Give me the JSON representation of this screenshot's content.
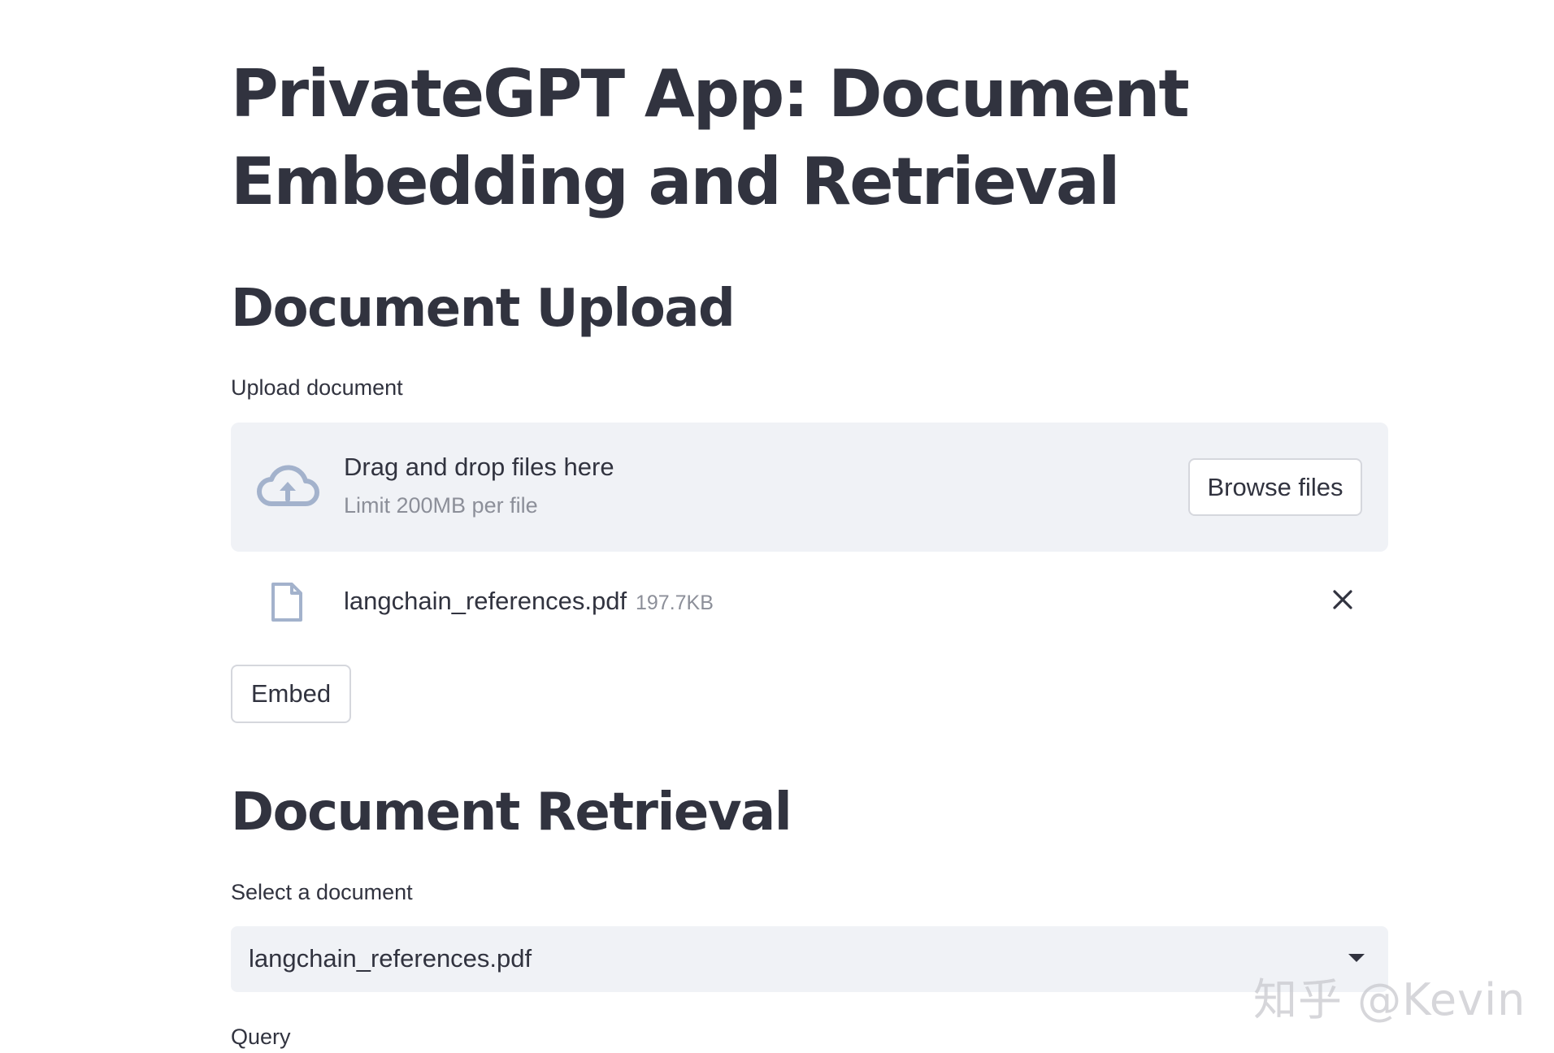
{
  "title": "PrivateGPT App: Document Embedding and Retrieval",
  "upload_section": {
    "heading": "Document Upload",
    "label": "Upload document",
    "dropzone": {
      "icon": "cloud-upload-icon",
      "main_text": "Drag and drop files here",
      "limit_text": "Limit 200MB per file",
      "browse_label": "Browse files"
    },
    "uploaded_file": {
      "icon": "file-icon",
      "name": "langchain_references.pdf",
      "size": "197.7KB",
      "remove_icon": "close-icon"
    },
    "embed_label": "Embed"
  },
  "retrieval_section": {
    "heading": "Document Retrieval",
    "select_label": "Select a document",
    "selected_document": "langchain_references.pdf",
    "caret_icon": "caret-down-icon",
    "query_label": "Query"
  },
  "watermark": "知乎 @Kevin",
  "colors": {
    "text": "#31333f",
    "muted": "#8c8f99",
    "surface": "#f0f2f6",
    "icon": "#a3b2cc",
    "border": "#d5d7dd"
  }
}
